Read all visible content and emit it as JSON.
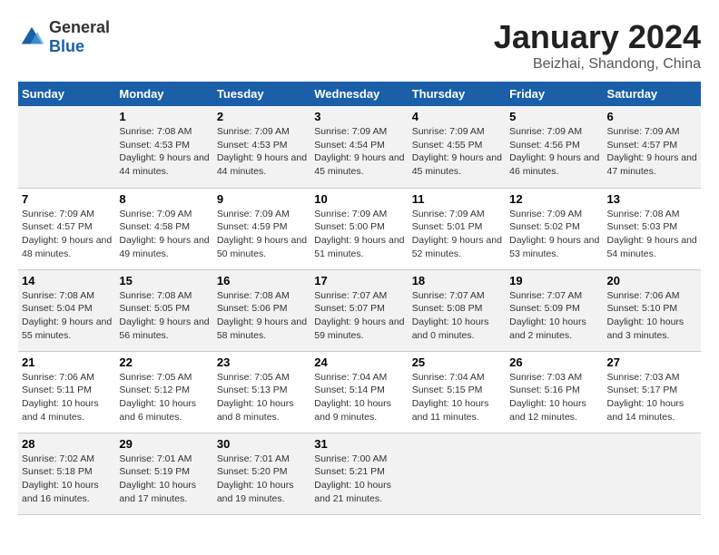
{
  "logo": {
    "text_general": "General",
    "text_blue": "Blue"
  },
  "title": "January 2024",
  "subtitle": "Beizhai, Shandong, China",
  "days_of_week": [
    "Sunday",
    "Monday",
    "Tuesday",
    "Wednesday",
    "Thursday",
    "Friday",
    "Saturday"
  ],
  "weeks": [
    [
      {
        "num": "",
        "sunrise": "",
        "sunset": "",
        "daylight": ""
      },
      {
        "num": "1",
        "sunrise": "Sunrise: 7:08 AM",
        "sunset": "Sunset: 4:53 PM",
        "daylight": "Daylight: 9 hours and 44 minutes."
      },
      {
        "num": "2",
        "sunrise": "Sunrise: 7:09 AM",
        "sunset": "Sunset: 4:53 PM",
        "daylight": "Daylight: 9 hours and 44 minutes."
      },
      {
        "num": "3",
        "sunrise": "Sunrise: 7:09 AM",
        "sunset": "Sunset: 4:54 PM",
        "daylight": "Daylight: 9 hours and 45 minutes."
      },
      {
        "num": "4",
        "sunrise": "Sunrise: 7:09 AM",
        "sunset": "Sunset: 4:55 PM",
        "daylight": "Daylight: 9 hours and 45 minutes."
      },
      {
        "num": "5",
        "sunrise": "Sunrise: 7:09 AM",
        "sunset": "Sunset: 4:56 PM",
        "daylight": "Daylight: 9 hours and 46 minutes."
      },
      {
        "num": "6",
        "sunrise": "Sunrise: 7:09 AM",
        "sunset": "Sunset: 4:57 PM",
        "daylight": "Daylight: 9 hours and 47 minutes."
      }
    ],
    [
      {
        "num": "7",
        "sunrise": "Sunrise: 7:09 AM",
        "sunset": "Sunset: 4:57 PM",
        "daylight": "Daylight: 9 hours and 48 minutes."
      },
      {
        "num": "8",
        "sunrise": "Sunrise: 7:09 AM",
        "sunset": "Sunset: 4:58 PM",
        "daylight": "Daylight: 9 hours and 49 minutes."
      },
      {
        "num": "9",
        "sunrise": "Sunrise: 7:09 AM",
        "sunset": "Sunset: 4:59 PM",
        "daylight": "Daylight: 9 hours and 50 minutes."
      },
      {
        "num": "10",
        "sunrise": "Sunrise: 7:09 AM",
        "sunset": "Sunset: 5:00 PM",
        "daylight": "Daylight: 9 hours and 51 minutes."
      },
      {
        "num": "11",
        "sunrise": "Sunrise: 7:09 AM",
        "sunset": "Sunset: 5:01 PM",
        "daylight": "Daylight: 9 hours and 52 minutes."
      },
      {
        "num": "12",
        "sunrise": "Sunrise: 7:09 AM",
        "sunset": "Sunset: 5:02 PM",
        "daylight": "Daylight: 9 hours and 53 minutes."
      },
      {
        "num": "13",
        "sunrise": "Sunrise: 7:08 AM",
        "sunset": "Sunset: 5:03 PM",
        "daylight": "Daylight: 9 hours and 54 minutes."
      }
    ],
    [
      {
        "num": "14",
        "sunrise": "Sunrise: 7:08 AM",
        "sunset": "Sunset: 5:04 PM",
        "daylight": "Daylight: 9 hours and 55 minutes."
      },
      {
        "num": "15",
        "sunrise": "Sunrise: 7:08 AM",
        "sunset": "Sunset: 5:05 PM",
        "daylight": "Daylight: 9 hours and 56 minutes."
      },
      {
        "num": "16",
        "sunrise": "Sunrise: 7:08 AM",
        "sunset": "Sunset: 5:06 PM",
        "daylight": "Daylight: 9 hours and 58 minutes."
      },
      {
        "num": "17",
        "sunrise": "Sunrise: 7:07 AM",
        "sunset": "Sunset: 5:07 PM",
        "daylight": "Daylight: 9 hours and 59 minutes."
      },
      {
        "num": "18",
        "sunrise": "Sunrise: 7:07 AM",
        "sunset": "Sunset: 5:08 PM",
        "daylight": "Daylight: 10 hours and 0 minutes."
      },
      {
        "num": "19",
        "sunrise": "Sunrise: 7:07 AM",
        "sunset": "Sunset: 5:09 PM",
        "daylight": "Daylight: 10 hours and 2 minutes."
      },
      {
        "num": "20",
        "sunrise": "Sunrise: 7:06 AM",
        "sunset": "Sunset: 5:10 PM",
        "daylight": "Daylight: 10 hours and 3 minutes."
      }
    ],
    [
      {
        "num": "21",
        "sunrise": "Sunrise: 7:06 AM",
        "sunset": "Sunset: 5:11 PM",
        "daylight": "Daylight: 10 hours and 4 minutes."
      },
      {
        "num": "22",
        "sunrise": "Sunrise: 7:05 AM",
        "sunset": "Sunset: 5:12 PM",
        "daylight": "Daylight: 10 hours and 6 minutes."
      },
      {
        "num": "23",
        "sunrise": "Sunrise: 7:05 AM",
        "sunset": "Sunset: 5:13 PM",
        "daylight": "Daylight: 10 hours and 8 minutes."
      },
      {
        "num": "24",
        "sunrise": "Sunrise: 7:04 AM",
        "sunset": "Sunset: 5:14 PM",
        "daylight": "Daylight: 10 hours and 9 minutes."
      },
      {
        "num": "25",
        "sunrise": "Sunrise: 7:04 AM",
        "sunset": "Sunset: 5:15 PM",
        "daylight": "Daylight: 10 hours and 11 minutes."
      },
      {
        "num": "26",
        "sunrise": "Sunrise: 7:03 AM",
        "sunset": "Sunset: 5:16 PM",
        "daylight": "Daylight: 10 hours and 12 minutes."
      },
      {
        "num": "27",
        "sunrise": "Sunrise: 7:03 AM",
        "sunset": "Sunset: 5:17 PM",
        "daylight": "Daylight: 10 hours and 14 minutes."
      }
    ],
    [
      {
        "num": "28",
        "sunrise": "Sunrise: 7:02 AM",
        "sunset": "Sunset: 5:18 PM",
        "daylight": "Daylight: 10 hours and 16 minutes."
      },
      {
        "num": "29",
        "sunrise": "Sunrise: 7:01 AM",
        "sunset": "Sunset: 5:19 PM",
        "daylight": "Daylight: 10 hours and 17 minutes."
      },
      {
        "num": "30",
        "sunrise": "Sunrise: 7:01 AM",
        "sunset": "Sunset: 5:20 PM",
        "daylight": "Daylight: 10 hours and 19 minutes."
      },
      {
        "num": "31",
        "sunrise": "Sunrise: 7:00 AM",
        "sunset": "Sunset: 5:21 PM",
        "daylight": "Daylight: 10 hours and 21 minutes."
      },
      {
        "num": "",
        "sunrise": "",
        "sunset": "",
        "daylight": ""
      },
      {
        "num": "",
        "sunrise": "",
        "sunset": "",
        "daylight": ""
      },
      {
        "num": "",
        "sunrise": "",
        "sunset": "",
        "daylight": ""
      }
    ]
  ]
}
